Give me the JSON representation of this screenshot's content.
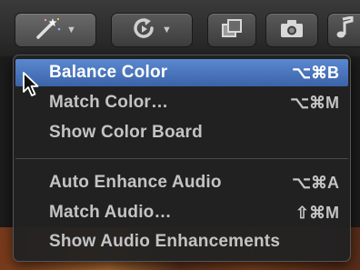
{
  "toolbar": {
    "buttons": [
      {
        "name": "enhancements-menu-button",
        "icon": "magic-wand-icon",
        "has_menu": true
      },
      {
        "name": "retiming-menu-button",
        "icon": "retime-icon",
        "has_menu": true
      },
      {
        "name": "transitions-browser-button",
        "icon": "layers-icon",
        "has_menu": false
      },
      {
        "name": "photos-browser-button",
        "icon": "camera-icon",
        "has_menu": false
      },
      {
        "name": "music-browser-button",
        "icon": "music-note-icon",
        "has_menu": false
      }
    ]
  },
  "menu": {
    "items": [
      {
        "label": "Balance Color",
        "shortcut": "⌥⌘B",
        "highlighted": true
      },
      {
        "label": "Match Color…",
        "shortcut": "⌥⌘M"
      },
      {
        "label": "Show Color Board",
        "shortcut": ""
      },
      {
        "label": "Auto Enhance Audio",
        "shortcut": "⌥⌘A"
      },
      {
        "label": "Match Audio…",
        "shortcut": "⇧⌘M"
      },
      {
        "label": "Show Audio Enhancements",
        "shortcut": ""
      }
    ]
  },
  "colors": {
    "highlight": "#4a78c4",
    "menu_bg": "#222222",
    "text": "#c4c4c4"
  }
}
